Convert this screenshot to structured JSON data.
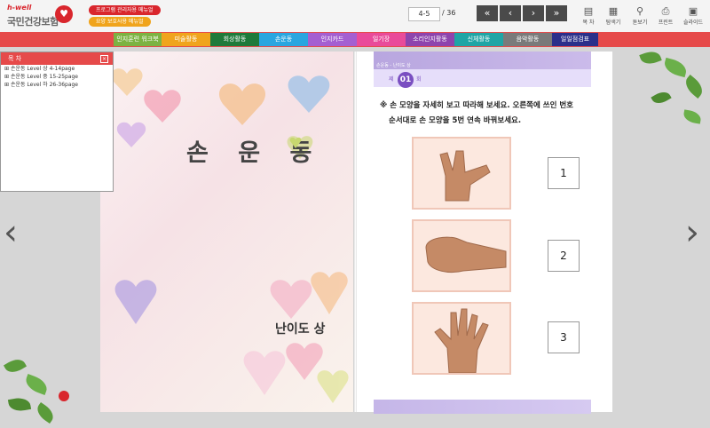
{
  "logo": {
    "tagline": "h-well",
    "name": "국민건강보험"
  },
  "pills": {
    "manager_menu": "프로그램 관리자용 메뉴얼",
    "caregiver_menu": "요양 보호사용 메뉴얼"
  },
  "pager": {
    "current": "4-5",
    "total": "/ 36"
  },
  "nav": {
    "first": "«",
    "prev": "‹",
    "next": "›",
    "last": "»"
  },
  "tools": [
    {
      "icon": "toc-icon",
      "label": "목 차"
    },
    {
      "icon": "grid-icon",
      "label": "탐색기"
    },
    {
      "icon": "zoom-icon",
      "label": "돋보기"
    },
    {
      "icon": "print-icon",
      "label": "프린트"
    },
    {
      "icon": "slide-icon",
      "label": "슬라이드"
    }
  ],
  "menu": [
    {
      "label": "인지훈련 워크북",
      "color": "#7cb342"
    },
    {
      "label": "미술활동",
      "color": "#f0a41c"
    },
    {
      "label": "회상활동",
      "color": "#1e7a3a"
    },
    {
      "label": "손운동",
      "color": "#29a6e0"
    },
    {
      "label": "인지카드",
      "color": "#a45fd1"
    },
    {
      "label": "일기장",
      "color": "#e94b9a"
    },
    {
      "label": "소리인지활동",
      "color": "#8e44ad"
    },
    {
      "label": "신체활동",
      "color": "#1fa5a5"
    },
    {
      "label": "음악활동",
      "color": "#7a7a7a"
    },
    {
      "label": "일일점검표",
      "color": "#2b2f8a"
    }
  ],
  "toc": {
    "title": "목 차",
    "items": [
      "손운동 Level 상 4-14page",
      "손운동 Level 중 15-25page",
      "손운동 Level 하 26-36page"
    ]
  },
  "left_page": {
    "title": "손 운 동",
    "level": "난이도 상"
  },
  "right_page": {
    "crumb": "손운동 - 난이도 상",
    "badge_prefix": "제",
    "badge": "01",
    "badge_suffix": "회",
    "instruction_line1": "※ 손 모양을 자세히 보고 따라해 보세요. 오른쪽에 쓰인 번호",
    "instruction_line2": "순서대로 손 모양을 5번 연속 바꿔보세요.",
    "steps": [
      "1",
      "2",
      "3"
    ]
  }
}
